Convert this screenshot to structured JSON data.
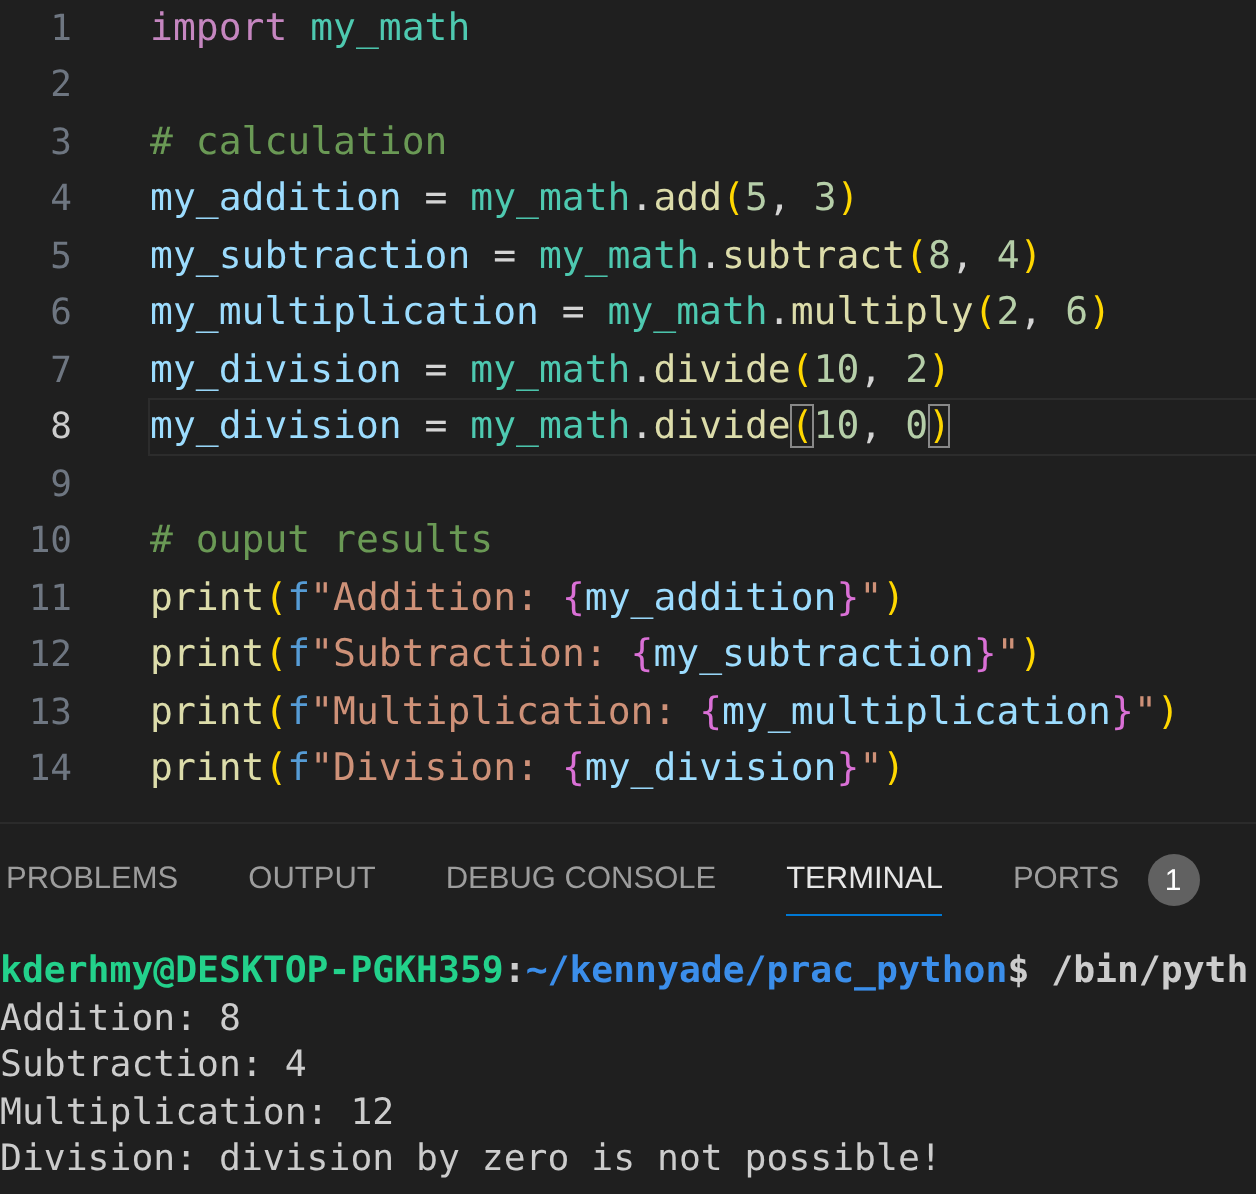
{
  "editor": {
    "lines": [
      {
        "number": "1",
        "current": false,
        "tokens": [
          {
            "kind": "keyword",
            "text": "import"
          },
          {
            "kind": "module",
            "text": " my_math"
          }
        ]
      },
      {
        "number": "2",
        "current": false
      },
      {
        "number": "3",
        "current": false,
        "tokens": [
          {
            "kind": "comment",
            "text": "# calculation"
          }
        ]
      },
      {
        "number": "4",
        "current": false,
        "tokens": [
          {
            "kind": "variable",
            "text": "my_addition"
          },
          {
            "kind": "plain",
            "text": " = "
          },
          {
            "kind": "module",
            "text": "my_math"
          },
          {
            "kind": "plain",
            "text": "."
          },
          {
            "kind": "func",
            "text": "add"
          },
          {
            "kind": "paren",
            "text": "("
          },
          {
            "kind": "number",
            "text": "5"
          },
          {
            "kind": "plain",
            "text": ", "
          },
          {
            "kind": "number",
            "text": "3"
          },
          {
            "kind": "paren",
            "text": ")"
          }
        ]
      },
      {
        "number": "5",
        "current": false,
        "tokens": [
          {
            "kind": "variable",
            "text": "my_subtraction"
          },
          {
            "kind": "plain",
            "text": " = "
          },
          {
            "kind": "module",
            "text": "my_math"
          },
          {
            "kind": "plain",
            "text": "."
          },
          {
            "kind": "func",
            "text": "subtract"
          },
          {
            "kind": "paren",
            "text": "("
          },
          {
            "kind": "number",
            "text": "8"
          },
          {
            "kind": "plain",
            "text": ", "
          },
          {
            "kind": "number",
            "text": "4"
          },
          {
            "kind": "paren",
            "text": ")"
          }
        ]
      },
      {
        "number": "6",
        "current": false,
        "tokens": [
          {
            "kind": "variable",
            "text": "my_multiplication"
          },
          {
            "kind": "plain",
            "text": " = "
          },
          {
            "kind": "module",
            "text": "my_math"
          },
          {
            "kind": "plain",
            "text": "."
          },
          {
            "kind": "func",
            "text": "multiply"
          },
          {
            "kind": "paren",
            "text": "("
          },
          {
            "kind": "number",
            "text": "2"
          },
          {
            "kind": "plain",
            "text": ", "
          },
          {
            "kind": "number",
            "text": "6"
          },
          {
            "kind": "paren",
            "text": ")"
          }
        ]
      },
      {
        "number": "7",
        "current": false,
        "tokens": [
          {
            "kind": "variable",
            "text": "my_division"
          },
          {
            "kind": "plain",
            "text": " = "
          },
          {
            "kind": "module",
            "text": "my_math"
          },
          {
            "kind": "plain",
            "text": "."
          },
          {
            "kind": "func",
            "text": "divide"
          },
          {
            "kind": "paren",
            "text": "("
          },
          {
            "kind": "number",
            "text": "10"
          },
          {
            "kind": "plain",
            "text": ", "
          },
          {
            "kind": "number",
            "text": "2"
          },
          {
            "kind": "paren",
            "text": ")"
          }
        ]
      },
      {
        "number": "8",
        "current": true,
        "tokens": [
          {
            "kind": "variable",
            "text": "my_division"
          },
          {
            "kind": "plain",
            "text": " = "
          },
          {
            "kind": "module",
            "text": "my_math"
          },
          {
            "kind": "plain",
            "text": "."
          },
          {
            "kind": "func",
            "text": "divide"
          },
          {
            "kind": "paren",
            "text": "(",
            "matched": true
          },
          {
            "kind": "number",
            "text": "10"
          },
          {
            "kind": "plain",
            "text": ", "
          },
          {
            "kind": "number",
            "text": "0"
          },
          {
            "kind": "paren",
            "text": ")",
            "matched": true
          }
        ]
      },
      {
        "number": "9",
        "current": false
      },
      {
        "number": "10",
        "current": false,
        "tokens": [
          {
            "kind": "comment",
            "text": "# ouput results"
          }
        ]
      },
      {
        "number": "11",
        "current": false,
        "tokens": [
          {
            "kind": "func",
            "text": "print"
          },
          {
            "kind": "paren",
            "text": "("
          },
          {
            "kind": "prefix",
            "text": "f"
          },
          {
            "kind": "string",
            "text": "\"Addition: "
          },
          {
            "kind": "brace",
            "text": "{"
          },
          {
            "kind": "variable",
            "text": "my_addition"
          },
          {
            "kind": "brace",
            "text": "}"
          },
          {
            "kind": "string",
            "text": "\""
          },
          {
            "kind": "paren",
            "text": ")"
          }
        ]
      },
      {
        "number": "12",
        "current": false,
        "tokens": [
          {
            "kind": "func",
            "text": "print"
          },
          {
            "kind": "paren",
            "text": "("
          },
          {
            "kind": "prefix",
            "text": "f"
          },
          {
            "kind": "string",
            "text": "\"Subtraction: "
          },
          {
            "kind": "brace",
            "text": "{"
          },
          {
            "kind": "variable",
            "text": "my_subtraction"
          },
          {
            "kind": "brace",
            "text": "}"
          },
          {
            "kind": "string",
            "text": "\""
          },
          {
            "kind": "paren",
            "text": ")"
          }
        ]
      },
      {
        "number": "13",
        "current": false,
        "tokens": [
          {
            "kind": "func",
            "text": "print"
          },
          {
            "kind": "paren",
            "text": "("
          },
          {
            "kind": "prefix",
            "text": "f"
          },
          {
            "kind": "string",
            "text": "\"Multiplication: "
          },
          {
            "kind": "brace",
            "text": "{"
          },
          {
            "kind": "variable",
            "text": "my_multiplication"
          },
          {
            "kind": "brace",
            "text": "}"
          },
          {
            "kind": "string",
            "text": "\""
          },
          {
            "kind": "paren",
            "text": ")"
          }
        ]
      },
      {
        "number": "14",
        "current": false,
        "tokens": [
          {
            "kind": "func",
            "text": "print"
          },
          {
            "kind": "paren",
            "text": "("
          },
          {
            "kind": "prefix",
            "text": "f"
          },
          {
            "kind": "string",
            "text": "\"Division: "
          },
          {
            "kind": "brace",
            "text": "{"
          },
          {
            "kind": "variable",
            "text": "my_division"
          },
          {
            "kind": "brace",
            "text": "}"
          },
          {
            "kind": "string",
            "text": "\""
          },
          {
            "kind": "paren",
            "text": ")"
          }
        ]
      }
    ]
  },
  "panel": {
    "tabs": [
      {
        "label": "PROBLEMS",
        "selected": false
      },
      {
        "label": "OUTPUT",
        "selected": false
      },
      {
        "label": "DEBUG CONSOLE",
        "selected": false
      },
      {
        "label": "TERMINAL",
        "selected": true
      },
      {
        "label": "PORTS",
        "selected": false,
        "badge": "1"
      }
    ],
    "terminal": {
      "prompt": [
        {
          "kind": "host",
          "text": "kderhmy@DESKTOP-PGKH359"
        },
        {
          "kind": "plain",
          "text": ":"
        },
        {
          "kind": "path",
          "text": "~/kennyade/prac_python"
        },
        {
          "kind": "plain",
          "text": "$ /bin/pyth"
        }
      ],
      "output": [
        "Addition: 8",
        "Subtraction: 4",
        "Multiplication: 12",
        "Division: division by zero is not possible!"
      ]
    }
  }
}
